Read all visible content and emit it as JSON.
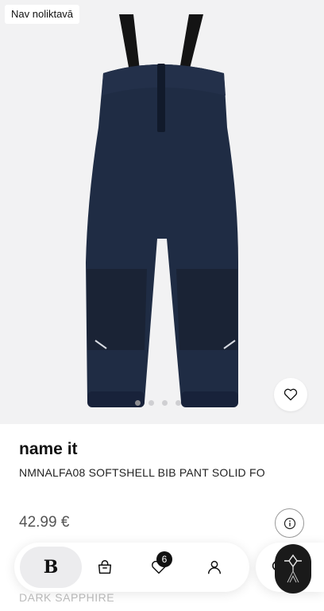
{
  "product": {
    "stock_label": "Nav noliktavā",
    "brand": "name it",
    "name": "NMNALFA08 SOFTSHELL BIB PANT SOLID FO",
    "price": "42.99 €",
    "color": "DARK SAPPHIRE",
    "image_icon": "pants-illustration",
    "gallery": {
      "count": 4,
      "active_index": 0
    }
  },
  "actions": {
    "favorite_icon": "heart-icon",
    "info_icon": "info-icon"
  },
  "nav": {
    "home_logo": "B",
    "home_icon": "brand-logo",
    "bag_icon": "shopping-bag-icon",
    "wishlist_icon": "heart-icon",
    "wishlist_count": "6",
    "account_icon": "user-icon",
    "search_icon": "search-icon",
    "assistant_icon": "assistant-icon"
  },
  "colors": {
    "image_bg": "#f2f2f3",
    "pants": "#1f2c44",
    "tabbar_bg": "#ffffff",
    "assistant_bg": "#1a1a1a"
  }
}
